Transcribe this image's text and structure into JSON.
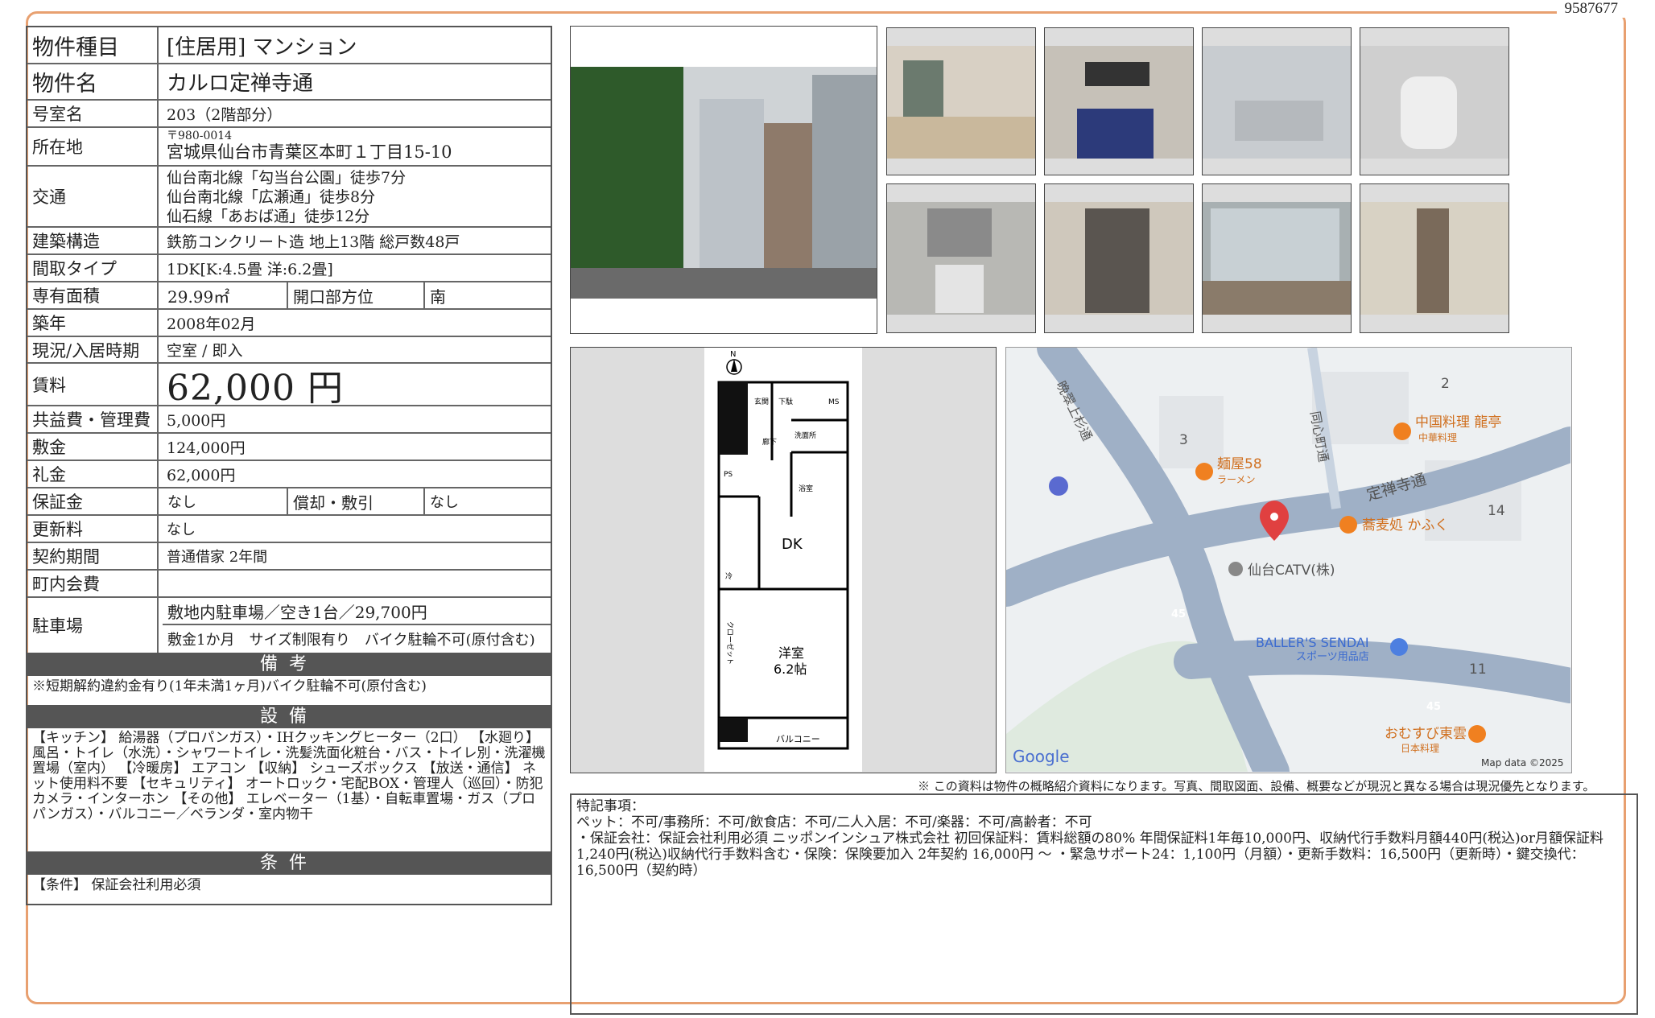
{
  "doc_id": "9587677",
  "spec": {
    "type_label": "物件種目",
    "type_value": "[住居用]  マンション",
    "name_label": "物件名",
    "name_value": "カルロ定禅寺通",
    "room_label": "号室名",
    "room_value": "203（2階部分）",
    "addr_label": "所在地",
    "addr_zip": "〒980-0014",
    "addr_value": "宮城県仙台市青葉区本町１丁目15-10",
    "access_label": "交通",
    "access": [
      "仙台南北線「勾当台公園」徒歩7分",
      "仙台南北線「広瀬通」徒歩8分",
      "仙石線「あおば通」徒歩12分"
    ],
    "structure_label": "建築構造",
    "structure_value": "鉄筋コンクリート造 地上13階 総戸数48戸",
    "layout_label": "間取タイプ",
    "layout_value": "1DK[K:4.5畳 洋:6.2畳]",
    "area_label": "専有面積",
    "area_value": "29.99㎡",
    "direction_label": "開口部方位",
    "direction_value": "南",
    "built_label": "築年",
    "built_value": "2008年02月",
    "status_label": "現況/入居時期",
    "status_value": "空室 /  即入",
    "rent_label": "賃料",
    "rent_value": "62,000 円",
    "fee_label": "共益費・管理費",
    "fee_value": "5,000円",
    "deposit_label": "敷金",
    "deposit_value": "124,000円",
    "keymoney_label": "礼金",
    "keymoney_value": "62,000円",
    "guarantee_label": "保証金",
    "guarantee_value": "なし",
    "amort_label": "償却・敷引",
    "amort_value": "なし",
    "renew_label": "更新料",
    "renew_value": "なし",
    "contract_label": "契約期間",
    "contract_value": "普通借家 2年間",
    "assoc_label": "町内会費",
    "assoc_value": "",
    "parking_label": "駐車場",
    "parking_value1": "敷地内駐車場／空き1台／29,700円",
    "parking_value2": "敷金1か月　サイズ制限有り　バイク駐輪不可(原付含む)",
    "remarks_title": "備考",
    "remarks_text": "※短期解約違約金有り(1年未満1ヶ月)バイク駐輪不可(原付含む)",
    "equip_title": "設備",
    "equip_text": "【キッチン】 給湯器（プロパンガス）・IHクッキングヒーター（2口） 【水廻り】 風呂・トイレ（水洗）・シャワートイレ・洗髪洗面化粧台・バス・トイレ別・洗濯機置場（室内） 【冷暖房】 エアコン 【収納】 シューズボックス 【放送・通信】 ネット使用料不要 【セキュリティ】 オートロック・宅配BOX・管理人（巡回）・防犯カメラ・インターホン 【その他】 エレベーター（1基）・自転車置場・ガス（プロパンガス）・バルコニー／ベランダ・室内物干",
    "cond_title": "条件",
    "cond_text": "【条件】 保証会社利用必須"
  },
  "floorplan": {
    "north": "N",
    "entrance": "玄関",
    "shoes": "下駄",
    "ms": "MS",
    "ps": "PS",
    "corridor": "廊下",
    "wash": "洗面所",
    "bath": "浴室",
    "dk": "DK",
    "fridge": "冷",
    "closet": "クローゼット",
    "western": "洋室",
    "western_size": "6.2帖",
    "balcony": "バルコニー"
  },
  "map": {
    "streets": [
      "定禅寺通",
      "晩翠上杉通",
      "同心町通"
    ],
    "places": [
      "中国料理 龍亭",
      "中華料理",
      "麺屋58",
      "ラーメン",
      "蕎麦処 かふく",
      "仙台CATV(株)",
      "BALLER'S SENDAI",
      "スポーツ用品店",
      "おむすび東雲",
      "日本料理"
    ],
    "numbers": [
      "2",
      "3",
      "14",
      "11",
      "45",
      "45"
    ],
    "google": "Google",
    "mapdata": "Map data ©2025"
  },
  "disclaimer": "※ この資料は物件の概略紹介資料になります。写真、間取図面、設備、概要などが現況と異なる場合は現況優先となります。",
  "notes": {
    "title": "特記事項：",
    "line1": "ペット：不可/事務所：不可/飲食店：不可/二人入居：不可/楽器：不可/高齢者：不可",
    "line2": "・保証会社：保証会社利用必須 ニッポンインシュア株式会社 初回保証料：賃料総額の80% 年間保証料1年毎10,000円、収納代行手数料月額440円(税込)or月額保証料1,240円(税込)収納代行手数料含む・保険：保険要加入 2年契約 16,000円 ～ ・緊急サポート24：1,100円（月額）・更新手数料：16,500円（更新時）・鍵交換代：16,500円（契約時）"
  }
}
